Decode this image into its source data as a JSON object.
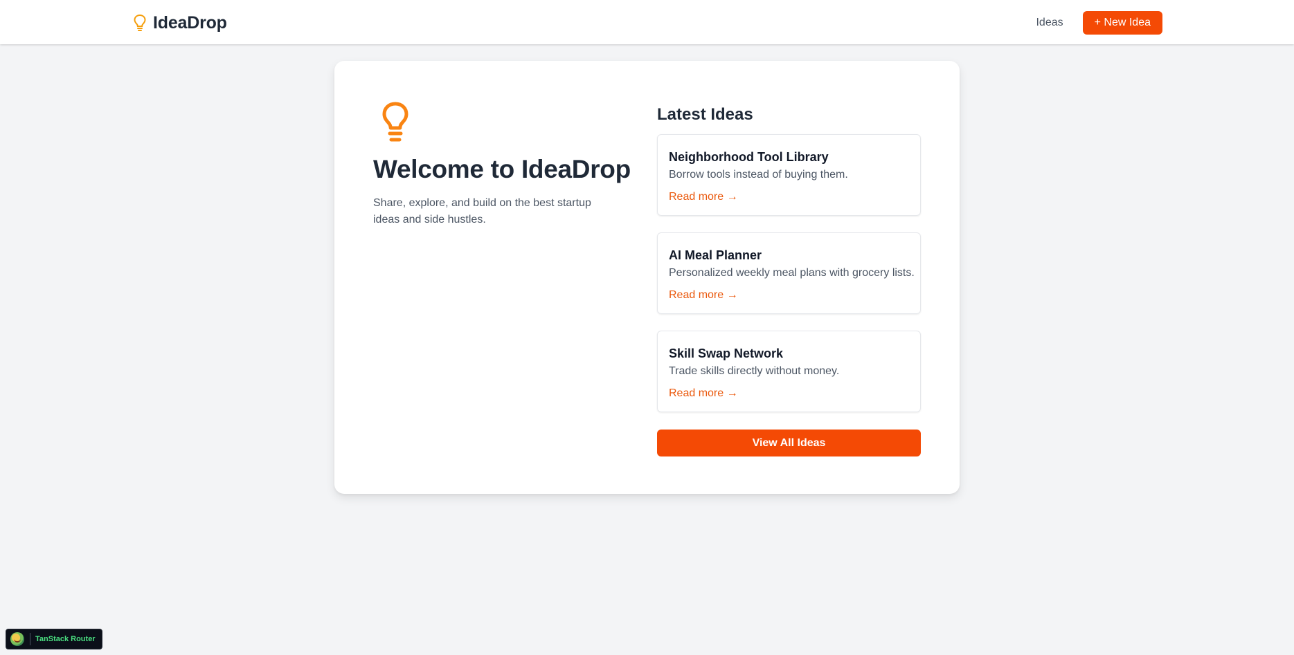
{
  "header": {
    "brand": "IdeaDrop",
    "brand_icon": "lightbulb-icon",
    "nav_ideas": "Ideas",
    "new_idea_button": "+ New Idea"
  },
  "hero": {
    "icon": "lightbulb-icon",
    "title": "Welcome to IdeaDrop",
    "subtitle": "Share, explore, and build on the best startup ideas and side hustles."
  },
  "latest": {
    "title": "Latest Ideas",
    "items": [
      {
        "title": "Neighborhood Tool Library",
        "summary": "Borrow tools instead of buying them.",
        "link": "Read more →"
      },
      {
        "title": "AI Meal Planner",
        "summary": "Personalized weekly meal plans with grocery lists.",
        "link": "Read more →"
      },
      {
        "title": "Skill Swap Network",
        "summary": "Trade skills directly without money.",
        "link": "Read more →"
      }
    ],
    "view_all_button": "View All Ideas"
  },
  "devtools": {
    "label": "TanStack Router",
    "logo": "tanstack-logo-icon"
  },
  "colors": {
    "accent": "#f44a05",
    "link": "#ea580c",
    "bulb": "#f59e0b",
    "background": "#f3f4f6"
  }
}
